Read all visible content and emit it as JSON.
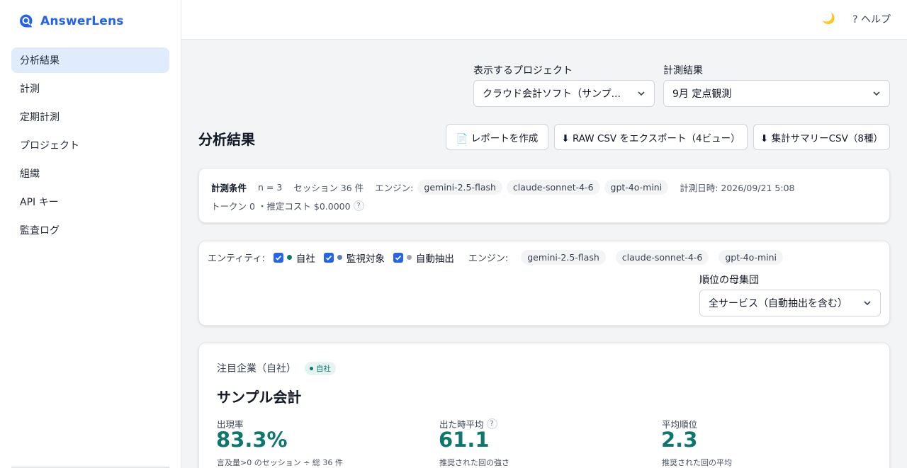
{
  "brand": {
    "name": "AnswerLens",
    "icon": "search-chat-icon"
  },
  "sidebar": {
    "items": [
      {
        "label": "分析結果",
        "active": true
      },
      {
        "label": "計測",
        "active": false
      },
      {
        "label": "定期計測",
        "active": false
      },
      {
        "label": "プロジェクト",
        "active": false
      },
      {
        "label": "組織",
        "active": false
      },
      {
        "label": "API キー",
        "active": false
      },
      {
        "label": "監査ログ",
        "active": false
      }
    ]
  },
  "topbar": {
    "theme_icon": "moon-icon",
    "help_label": "? ヘルプ"
  },
  "filters": {
    "project_label": "表示するプロジェクト",
    "project_value": "クラウド会計ソフト（サンプ...",
    "result_label": "計測結果",
    "result_value": "9月 定点観測"
  },
  "page": {
    "title": "分析結果"
  },
  "actions": {
    "report_label": "📄 レポートを作成",
    "raw_csv_label": "⬇ RAW CSV をエクスポート（4ビュー）",
    "summary_csv_label": "⬇ 集計サマリーCSV（8種）"
  },
  "conditions": {
    "title": "計測条件",
    "n": "n = 3",
    "sessions": "セッション 36 件",
    "engine_label": "エンジン:",
    "engines": [
      "gemini-2.5-flash",
      "claude-sonnet-4-6",
      "gpt-4o-mini"
    ],
    "measured_at": "計測日時: 2026/09/21 5:08",
    "tokens_cost": "トークン 0 ・推定コスト $0.0000",
    "help": "?"
  },
  "entity_filter": {
    "label": "エンティティ:",
    "options": [
      {
        "label": "自社",
        "checked": true,
        "color": "#0f766e"
      },
      {
        "label": "監視対象",
        "checked": true,
        "color": "#5b7fb5"
      },
      {
        "label": "自動抽出",
        "checked": true,
        "color": "#9ca3af"
      }
    ],
    "engine_label": "エンジン:",
    "engines": [
      "gemini-2.5-flash",
      "claude-sonnet-4-6",
      "gpt-4o-mini"
    ],
    "population_label": "順位の母集団",
    "population_value": "全サービス（自動抽出を含む）"
  },
  "focus": {
    "heading": "注目企業（自社）",
    "badge": "自社",
    "company": "サンプル会計",
    "metrics": [
      {
        "label": "出現率",
        "value": "83.3%",
        "sub": "言及量>0 のセッション ÷ 総 36 件",
        "help": false
      },
      {
        "label": "出た時平均",
        "value": "61.1",
        "sub": "推奨された回の強さ",
        "help": true
      },
      {
        "label": "平均順位",
        "value": "2.3",
        "sub": "推奨された回の平均",
        "help": false
      }
    ]
  },
  "colors": {
    "accent": "#2563eb",
    "metric": "#0f766e",
    "active_nav": "#e0ebfb"
  }
}
